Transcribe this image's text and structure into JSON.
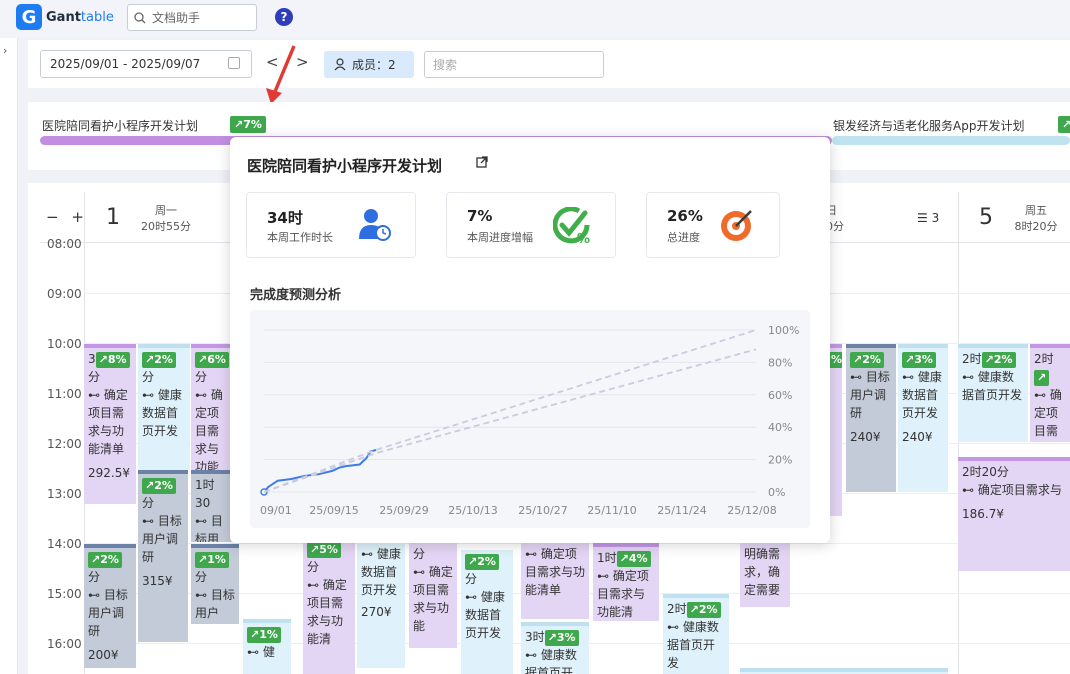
{
  "app": {
    "logo_letter": "G",
    "name_part1": "Gant",
    "name_part2": "table",
    "search_placeholder": "文档助手",
    "help_label": "?"
  },
  "toolbar": {
    "date_range": "2025/09/01 - 2025/09/07",
    "members_label": "成员：2",
    "search_placeholder": "搜索"
  },
  "projects": [
    {
      "name": "医院陪同看护小程序开发计划",
      "progress_badge": "↗7%"
    },
    {
      "name": "银发经济与适老化服务App开发计划",
      "progress_badge": "↗"
    }
  ],
  "calendar": {
    "zoom_out": "−",
    "zoom_in": "+",
    "days": [
      {
        "num": "1",
        "dow": "周一",
        "duration": "20时55分"
      },
      {
        "num": "",
        "dow": "日",
        "duration": "0分"
      },
      {
        "num": "5",
        "dow": "周五",
        "duration": "8时20分"
      }
    ],
    "list_count": "3",
    "hours": [
      "08:00",
      "09:00",
      "10:00",
      "11:00",
      "12:00",
      "13:00",
      "14:00",
      "15:00",
      "16:00"
    ]
  },
  "tasks": {
    "t1": {
      "dur": "3",
      "pct": "↗8%",
      "min": "分",
      "name": "确定项目需求与功能清单",
      "cost": "292.5¥"
    },
    "t2": {
      "pct": "↗2%",
      "min": "分",
      "name": "健康数据首页开发"
    },
    "t3": {
      "pct": "↗6%",
      "min": "分",
      "name": "确定项目需求与功能"
    },
    "t4": {
      "pct": "↗2%",
      "min": "分",
      "name": "目标用户调研",
      "cost": "315¥"
    },
    "t5": {
      "dur": "1时30",
      "name": "目标用户调研"
    },
    "t6": {
      "pct": "↗2%",
      "min": "分",
      "name": "目标用户调研",
      "cost": "200¥"
    },
    "t7": {
      "pct": "↗1%",
      "min": "分",
      "name": "目标用户"
    },
    "t8": {
      "pct": "↗1%",
      "name": "健"
    },
    "t9": {
      "pct": "↗5%",
      "min": "分",
      "name": "确定项目需求与功能清"
    },
    "t10": {
      "name": "健康数据首页开发",
      "cost": "270¥"
    },
    "t11": {
      "min": "分",
      "name": "确定项目需求与功能"
    },
    "t12": {
      "pct": "↗2%",
      "min": "分",
      "name": "健康数据首页开发"
    },
    "t13": {
      "name": "确定项目需求与功能清单"
    },
    "t14": {
      "dur": "3时",
      "pct": "↗3%",
      "name": "健康数据首页开"
    },
    "t15": {
      "dur": "1时",
      "pct": "↗4%",
      "name": "确定项目需求与功能清"
    },
    "t16": {
      "dur": "2时",
      "pct": "↗2%",
      "name": "健康数据首页开发"
    },
    "t17": {
      "name": "明确需求，确定需要"
    },
    "t18": {
      "pct": "%"
    },
    "t19": {
      "pct": "↗2%",
      "name": "目标用户调研",
      "cost": "240¥"
    },
    "t20": {
      "pct": "↗3%",
      "name": "健康数据首页开发",
      "cost": "240¥"
    },
    "t21": {
      "dur": "2时",
      "pct": "↗2%",
      "name": "健康数据首页开发"
    },
    "t22": {
      "dur": "2时",
      "pct": "↗",
      "name": "确定项目需求与功能单"
    },
    "t23": {
      "dur": "2时20分",
      "name": "确定项目需求与",
      "cost": "186.7¥"
    }
  },
  "popup": {
    "title": "医院陪同看护小程序开发计划",
    "stats": [
      {
        "value": "34时",
        "label": "本周工作时长",
        "icon": "user-clock-icon"
      },
      {
        "value": "7%",
        "label": "本周进度增幅",
        "icon": "progress-check-icon"
      },
      {
        "value": "26%",
        "label": "总进度",
        "icon": "target-icon"
      }
    ],
    "prediction_title": "完成度预测分析"
  },
  "chart_data": {
    "type": "line",
    "x_ticks": [
      "09/01",
      "25/09/15",
      "25/09/29",
      "25/10/13",
      "25/10/27",
      "25/11/10",
      "25/11/24",
      "25/12/08"
    ],
    "y_ticks": [
      "100%",
      "80%",
      "60%",
      "40%",
      "20%",
      "0%"
    ],
    "ylim": [
      0,
      100
    ],
    "series": [
      {
        "style": "solid",
        "color": "#3f7be8",
        "points": [
          [
            0,
            0
          ],
          [
            0.3,
            3
          ],
          [
            1,
            7
          ],
          [
            2,
            8
          ],
          [
            3,
            10
          ],
          [
            4,
            11
          ],
          [
            5,
            13
          ],
          [
            5.5,
            15
          ],
          [
            6,
            16
          ],
          [
            7,
            17
          ],
          [
            7.5,
            21
          ],
          [
            7.8,
            25
          ],
          [
            8.2,
            26
          ]
        ]
      },
      {
        "style": "dashed",
        "color": "#c9cbe0",
        "points": [
          [
            0,
            0
          ],
          [
            8.2,
            26
          ],
          [
            36,
            100
          ]
        ]
      },
      {
        "style": "dashed",
        "color": "#c9cbe0",
        "points": [
          [
            0,
            0
          ],
          [
            8.2,
            24
          ],
          [
            36,
            88
          ]
        ]
      }
    ],
    "x_domain": [
      0,
      36
    ]
  }
}
